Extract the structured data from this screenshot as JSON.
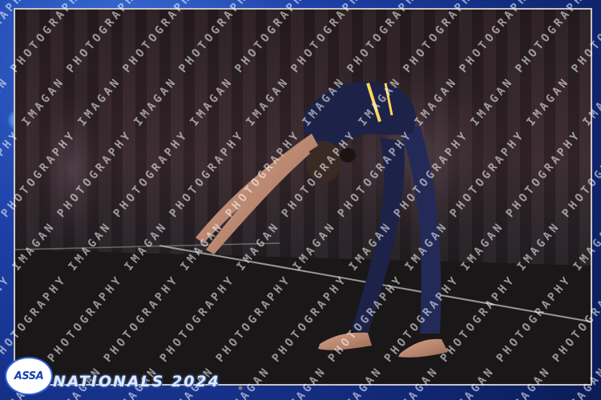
{
  "event_logo": {
    "text": "ASSA"
  },
  "event_title": "NATIONALS 2024",
  "watermark": {
    "text": "IMAGAN PHOTOGRAPHY",
    "color": "#ffffff"
  },
  "colors": {
    "frame_blue": "#1d3fa6",
    "accent_gold": "#ffd75a",
    "costume_navy": "#1c2248"
  }
}
